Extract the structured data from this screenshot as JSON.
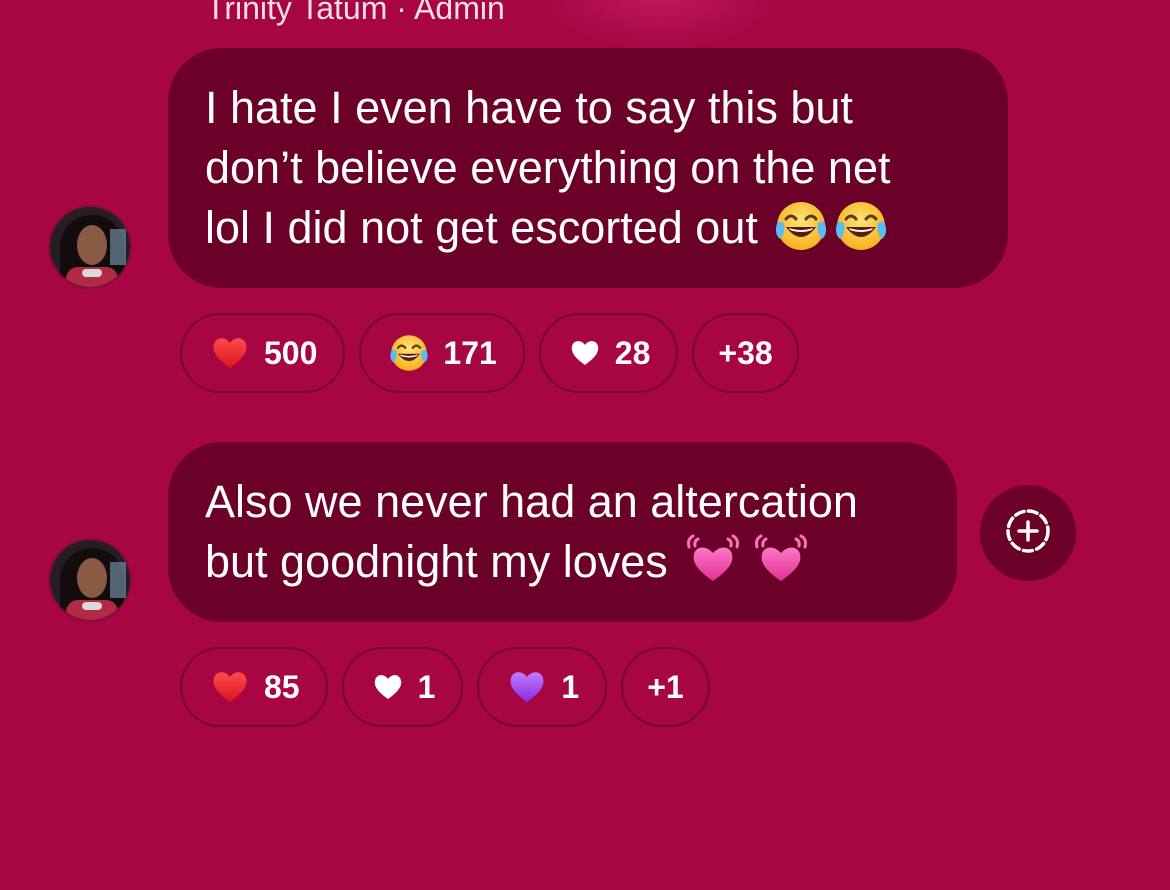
{
  "header": {
    "sender_line": "Trinity Tatum · Admin"
  },
  "messages": [
    {
      "lines": [
        "I hate I even have to say this but",
        "don’t believe everything on the net",
        "lol I did not get escorted out"
      ],
      "trailing_emojis": [
        "face-with-tears-of-joy-emoji",
        "face-with-tears-of-joy-emoji"
      ],
      "reactions": [
        {
          "icon": "red-heart-emoji",
          "count": "500"
        },
        {
          "icon": "face-with-tears-of-joy-emoji",
          "count": "171"
        },
        {
          "icon": "white-heart-emoji",
          "count": "28"
        },
        {
          "icon": "",
          "count": "+38"
        }
      ]
    },
    {
      "lines": [
        "Also we never had an altercation",
        "but goodnight my loves"
      ],
      "trailing_emojis": [
        "beating-heart-emoji",
        "beating-heart-emoji"
      ],
      "reactions": [
        {
          "icon": "red-heart-emoji",
          "count": "85"
        },
        {
          "icon": "white-heart-emoji",
          "count": "1"
        },
        {
          "icon": "purple-heart-emoji",
          "count": "1"
        },
        {
          "icon": "",
          "count": "+1"
        }
      ]
    }
  ],
  "actions": {
    "add_reaction_icon": "add-reaction-icon"
  },
  "colors": {
    "background": "#a80643",
    "bubble": "#6b0028",
    "chip_border": "#6e0a30",
    "text": "#ffffff"
  }
}
